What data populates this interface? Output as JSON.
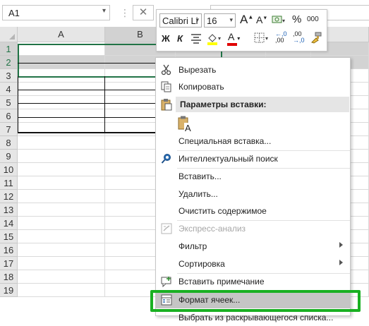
{
  "colors": {
    "highlight_box": "#19b022",
    "selected_row_header": "#d2d2d2",
    "excel_green": "#217346"
  },
  "formula_bar": {
    "name_box": "A1",
    "cancel_symbol": "✕"
  },
  "columns": [
    "A",
    "B"
  ],
  "rows": [
    "1",
    "2",
    "3",
    "4",
    "5",
    "6",
    "7",
    "8",
    "9",
    "10",
    "11",
    "12",
    "13",
    "14",
    "15",
    "16",
    "17",
    "18",
    "19"
  ],
  "mini_toolbar": {
    "font_name": "Calibri Li",
    "font_size": "16",
    "grow_font": "A",
    "shrink_font": "A",
    "percent": "%",
    "thousands": "000",
    "bold": "Ж",
    "italic": "К",
    "font_color": "А",
    "decrease_decimal": ",00",
    "increase_decimal": ",0"
  },
  "context_menu": {
    "cut": "Вырезать",
    "copy": "Копировать",
    "paste_header": "Параметры вставки:",
    "paste_special": "Специальная вставка...",
    "smart_lookup": "Интеллектуальный поиск",
    "insert": "Вставить...",
    "delete": "Удалить...",
    "clear": "Очистить содержимое",
    "quick_analysis": "Экспресс-анализ",
    "filter": "Фильтр",
    "sort": "Сортировка",
    "insert_comment": "Вставить примечание",
    "format_cells": "Формат ячеек...",
    "pick_from_list": "Выбрать из раскрывающегося списка..."
  }
}
